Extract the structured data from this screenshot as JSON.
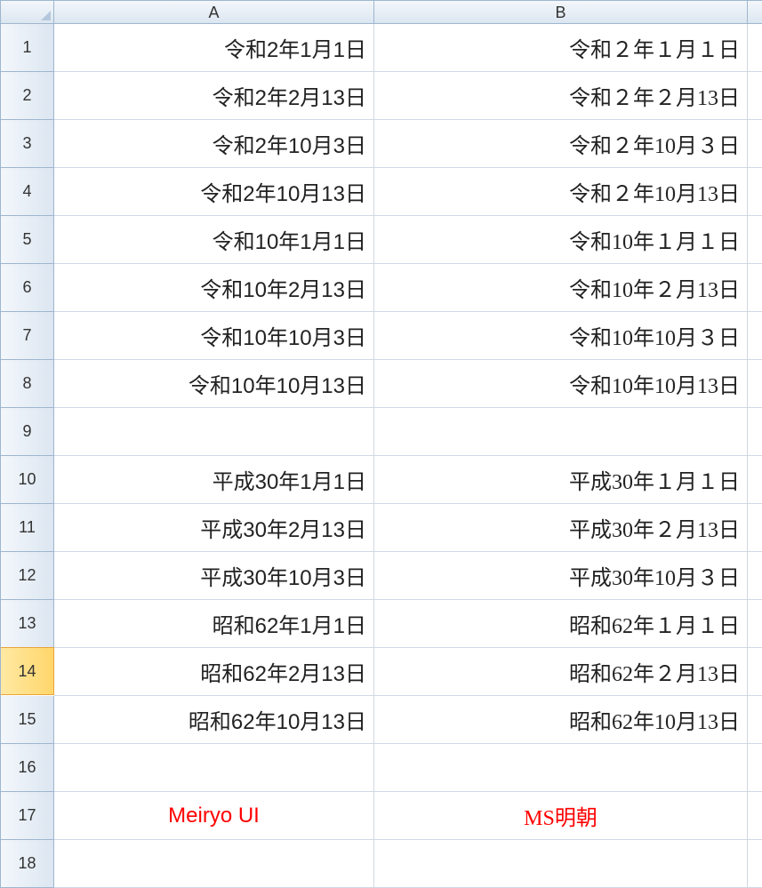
{
  "columns": [
    "A",
    "B"
  ],
  "selected_row": 14,
  "rows": [
    {
      "n": 1,
      "a": "令和2年1月1日",
      "b": "令和２年１月１日"
    },
    {
      "n": 2,
      "a": "令和2年2月13日",
      "b": "令和２年２月13日"
    },
    {
      "n": 3,
      "a": "令和2年10月3日",
      "b": "令和２年10月３日"
    },
    {
      "n": 4,
      "a": "令和2年10月13日",
      "b": "令和２年10月13日"
    },
    {
      "n": 5,
      "a": "令和10年1月1日",
      "b": "令和10年１月１日"
    },
    {
      "n": 6,
      "a": "令和10年2月13日",
      "b": "令和10年２月13日"
    },
    {
      "n": 7,
      "a": "令和10年10月3日",
      "b": "令和10年10月３日"
    },
    {
      "n": 8,
      "a": "令和10年10月13日",
      "b": "令和10年10月13日"
    },
    {
      "n": 9,
      "a": "",
      "b": ""
    },
    {
      "n": 10,
      "a": "平成30年1月1日",
      "b": "平成30年１月１日"
    },
    {
      "n": 11,
      "a": "平成30年2月13日",
      "b": "平成30年２月13日"
    },
    {
      "n": 12,
      "a": "平成30年10月3日",
      "b": "平成30年10月３日"
    },
    {
      "n": 13,
      "a": "昭和62年1月1日",
      "b": "昭和62年１月１日"
    },
    {
      "n": 14,
      "a": "昭和62年2月13日",
      "b": "昭和62年２月13日"
    },
    {
      "n": 15,
      "a": "昭和62年10月13日",
      "b": "昭和62年10月13日"
    },
    {
      "n": 16,
      "a": "",
      "b": ""
    },
    {
      "n": 17,
      "a": "Meiryo UI",
      "b": "MS明朝",
      "center": true,
      "red": true
    },
    {
      "n": 18,
      "a": "",
      "b": ""
    }
  ]
}
